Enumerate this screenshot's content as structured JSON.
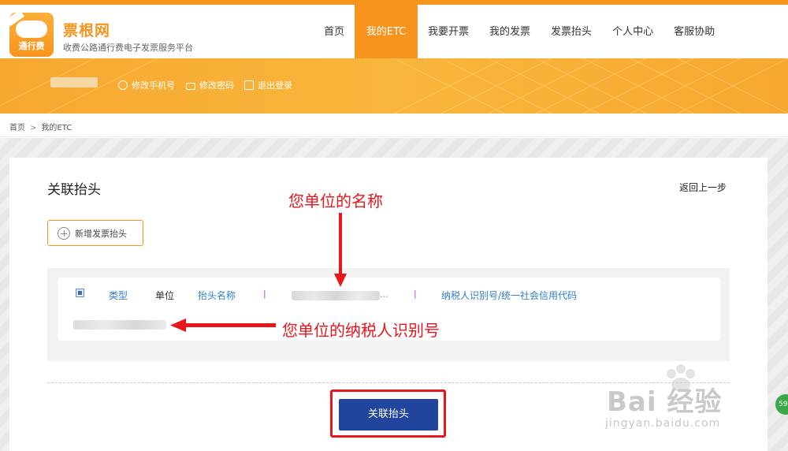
{
  "brand": {
    "logo_text": "通行费",
    "name": "票根网",
    "subtitle": "收费公路通行费电子发票服务平台"
  },
  "nav": {
    "items": [
      "首页",
      "我的ETC",
      "我要开票",
      "我的发票",
      "发票抬头",
      "个人中心",
      "客服协助"
    ],
    "active": "我的ETC"
  },
  "userbar": {
    "change_phone": "修改手机号",
    "change_password": "修改密码",
    "logout": "退出登录"
  },
  "breadcrumb": {
    "home": "首页",
    "sep": ">",
    "current": "我的ETC"
  },
  "page": {
    "title": "关联抬头",
    "back": "返回上一步",
    "add_button": "新增发票抬头"
  },
  "record": {
    "type_label": "类型",
    "type_value": "单位",
    "name_label": "抬头名称",
    "divider": "|",
    "ellipsis": "...",
    "tax_label": "纳税人识别号/统一社会信用代码"
  },
  "primary_button": "关联抬头",
  "annotations": {
    "name_hint": "您单位的名称",
    "tax_hint": "您单位的纳税人识别号"
  },
  "watermark": {
    "brand": "Bai 经验",
    "url": "jingyan.baidu.com"
  },
  "side_badge": "59",
  "colors": {
    "accent": "#f7941d",
    "primary": "#21449c",
    "link": "#2f7fc6",
    "annotation": "#e8161b"
  }
}
